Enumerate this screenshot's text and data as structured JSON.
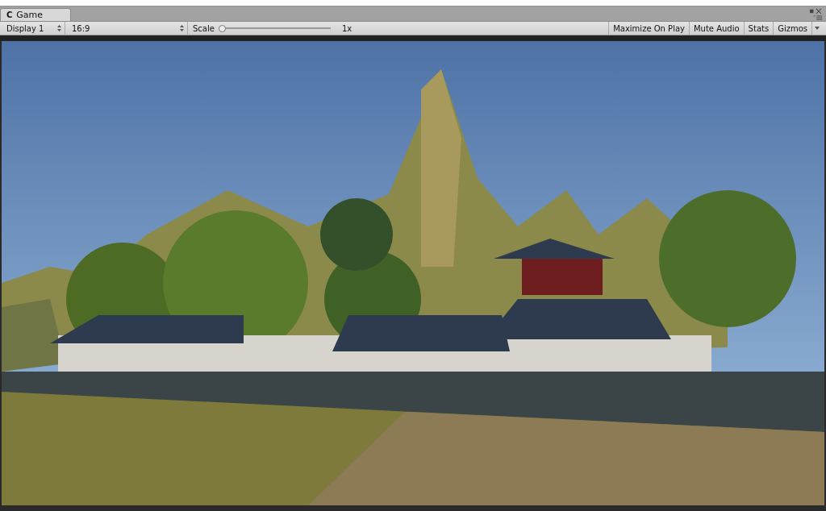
{
  "tab": {
    "icon": "C",
    "title": "Game"
  },
  "toolbar": {
    "display": "Display 1",
    "aspect": "16:9",
    "scale": {
      "label": "Scale",
      "level": 0,
      "reading": "1x"
    },
    "buttons": [
      "Maximize On Play",
      "Mute Audio",
      "Stats",
      "Gizmos"
    ]
  }
}
